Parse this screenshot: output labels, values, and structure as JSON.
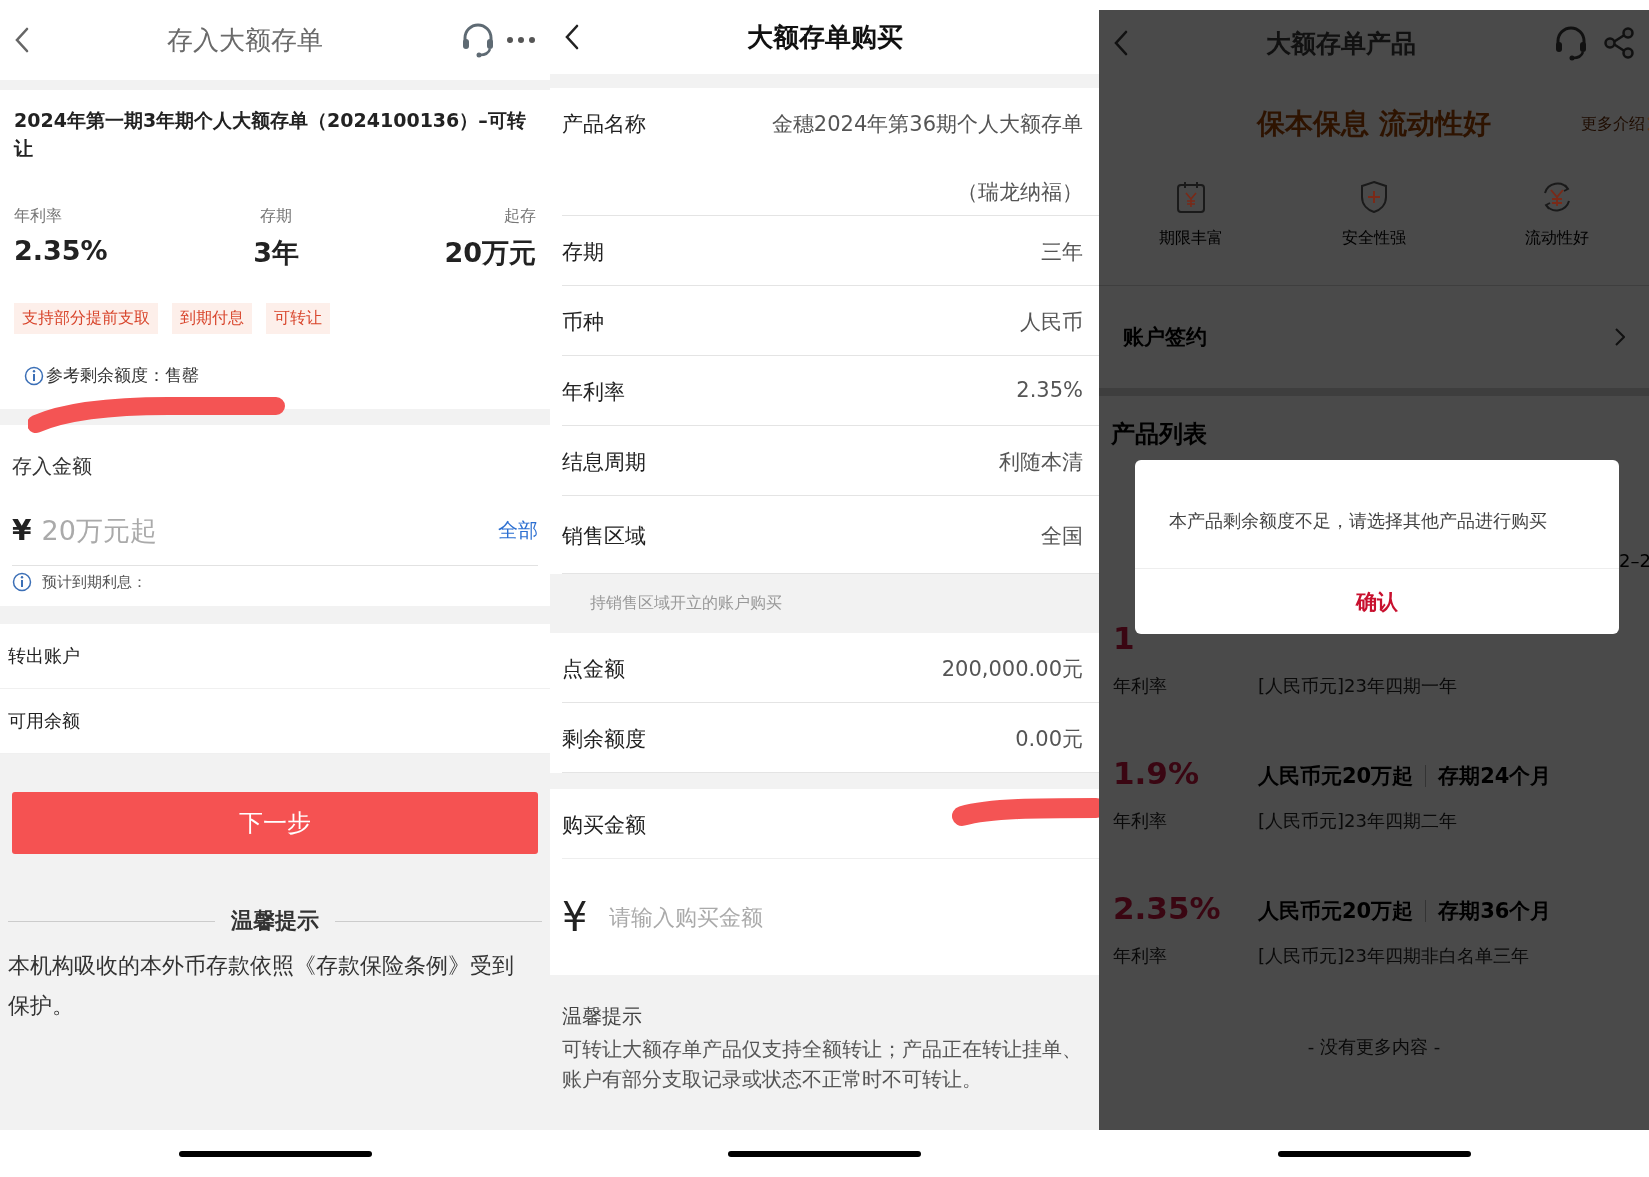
{
  "deposit_screen": {
    "nav": {
      "title": "存入大额存单"
    },
    "product": {
      "name": "2024年第一期3年期个人大额存单（2024100136）–可转让",
      "stats": [
        {
          "label": "年利率",
          "value": "2.35%"
        },
        {
          "label": "存期",
          "value": "3年"
        },
        {
          "label": "起存",
          "value": "20万元"
        }
      ],
      "tags": [
        "支持部分提前支取",
        "到期付息",
        "可转让"
      ],
      "quota_note": "参考剩余额度：售罄"
    },
    "amount": {
      "label": "存入金额",
      "currency": "¥",
      "placeholder": "20万元起",
      "all_link": "全部",
      "interest_note": "预计到期利息："
    },
    "account_rows": [
      {
        "label": "转出账户"
      },
      {
        "label": "可用余额"
      }
    ],
    "next_button": "下一步",
    "tips": {
      "title": "温馨提示",
      "text": "本机构吸收的本外币存款依照《存款保险条例》受到保护。"
    }
  },
  "purchase_screen": {
    "nav": {
      "title": "大额存单购买"
    },
    "rows": [
      {
        "label": "产品名称",
        "value_lines": [
          "金穗2024年第36期个人大额存单",
          "（瑞龙纳福）"
        ]
      },
      {
        "label": "存期",
        "value_lines": [
          "三年"
        ]
      },
      {
        "label": "币种",
        "value_lines": [
          "人民币"
        ]
      },
      {
        "label": "年利率",
        "value_lines": [
          "2.35%"
        ]
      },
      {
        "label": "结息周期",
        "value_lines": [
          "利随本清"
        ]
      },
      {
        "label": "销售区域",
        "value_lines": [
          "全国"
        ]
      }
    ],
    "region_note": "持销售区域开立的账户购买",
    "quota_rows": [
      {
        "label": "点金额",
        "value": "200,000.00元"
      },
      {
        "label": "剩余额度",
        "value": "0.00元"
      }
    ],
    "purchase": {
      "label": "购买金额",
      "currency": "¥",
      "placeholder": "请输入购买金额"
    },
    "tips": {
      "title": "温馨提示",
      "text": "可转让大额存单产品仅支持全额转让；产品正在转让挂单、账户有部分支取记录或状态不正常时不可转让。"
    }
  },
  "products_screen": {
    "nav": {
      "title": "大额存单产品"
    },
    "slogan": "保本保息 流动性好",
    "more_link": "更多介绍",
    "features": [
      {
        "kind": "calendar",
        "label": "期限丰富"
      },
      {
        "kind": "shield",
        "label": "安全性强"
      },
      {
        "kind": "cycle",
        "label": "流动性好"
      }
    ],
    "sign_row": "账户签约",
    "list_title": "产品列表",
    "products": [
      {
        "rate": "1",
        "rate_label": "年利率",
        "name": "[人民币元]23年四期一年",
        "edge_text": "2–2"
      },
      {
        "rate": "1.9%",
        "rate_label": "年利率",
        "amount": "人民币元20万起",
        "term": "存期24个月",
        "name": "[人民币元]23年四期二年"
      },
      {
        "rate": "2.35%",
        "rate_label": "年利率",
        "amount": "人民币元20万起",
        "term": "存期36个月",
        "name": "[人民币元]23年四期非白名单三年"
      }
    ],
    "footer": "- 没有更多内容 -",
    "dialog": {
      "message": "本产品剩余额度不足，请选择其他产品进行购买",
      "confirm": "确认"
    }
  }
}
